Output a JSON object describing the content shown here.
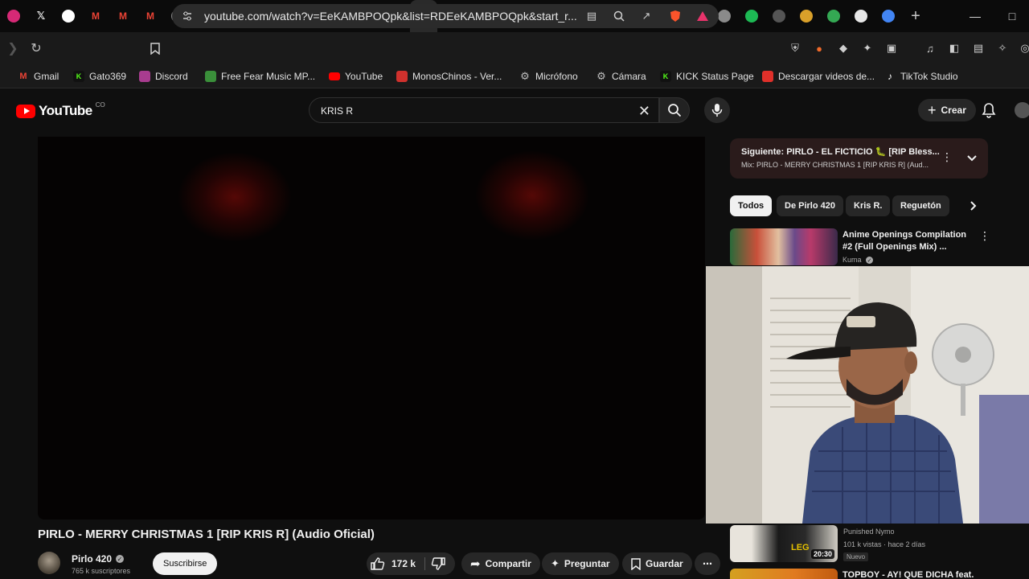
{
  "browser": {
    "tabs": [
      {
        "icon": "instagram-icon",
        "color": "#d62976",
        "active": false
      },
      {
        "icon": "x-icon",
        "color": "#ffffff",
        "active": false
      },
      {
        "icon": "tiktok-icon",
        "color": "#ffffff",
        "active": false
      },
      {
        "icon": "gmail-icon",
        "color": "#ea4335",
        "active": false
      },
      {
        "icon": "gmail-icon",
        "color": "#ea4335",
        "active": false
      },
      {
        "icon": "gmail-icon",
        "color": "#ea4335",
        "active": false
      },
      {
        "icon": "af-icon",
        "color": "#8a8a8a",
        "active": false
      },
      {
        "icon": "af-icon",
        "color": "#8a8a8a",
        "active": false
      },
      {
        "icon": "crescent-icon",
        "color": "#e0e0e0",
        "active": false
      },
      {
        "icon": "mw-icon",
        "color": "#6a6a6a",
        "active": false
      },
      {
        "icon": "telegram-icon",
        "color": "#2aa3dd",
        "active": false
      },
      {
        "icon": "google-icon",
        "color": "#4285f4",
        "active": false
      },
      {
        "icon": "blank-icon",
        "color": "#222222",
        "active": false
      },
      {
        "icon": "youtube-icon",
        "color": "#ff0000",
        "active": false
      },
      {
        "icon": "youtube-icon",
        "color": "#ff0000",
        "active": false
      },
      {
        "icon": "close-icon",
        "color": "#e8e8e8",
        "active": true
      },
      {
        "icon": "pumpkin-icon",
        "color": "#e0792a",
        "active": false
      },
      {
        "icon": "circle-icon",
        "color": "#7a7a7a",
        "active": false
      },
      {
        "icon": "google-icon",
        "color": "#4285f4",
        "active": false
      },
      {
        "icon": "red-circle-icon",
        "color": "#b8282a",
        "active": false
      },
      {
        "icon": "circle-icon",
        "color": "#8a8a8a",
        "active": false
      },
      {
        "icon": "red-circle-icon",
        "color": "#b8282a",
        "active": false
      },
      {
        "icon": "orange-circle-icon",
        "color": "#e05a1a",
        "active": false
      },
      {
        "icon": "google-icon",
        "color": "#4285f4",
        "active": false
      },
      {
        "icon": "circle-icon",
        "color": "#9a9a9a",
        "active": false
      },
      {
        "icon": "blue-square-icon",
        "color": "#3b6cd8",
        "active": false
      },
      {
        "icon": "af-icon",
        "color": "#8a8a8a",
        "active": false
      },
      {
        "icon": "spotify-icon",
        "color": "#1db954",
        "active": false
      },
      {
        "icon": "circle-icon",
        "color": "#555555",
        "active": false
      },
      {
        "icon": "colorful-icon",
        "color": "#d9a02a",
        "active": false
      },
      {
        "icon": "drive-icon",
        "color": "#34a853",
        "active": false
      },
      {
        "icon": "mute-icon",
        "color": "#e8e8e8",
        "active": false
      },
      {
        "icon": "google-icon",
        "color": "#4285f4",
        "active": false
      }
    ],
    "url": "youtube.com/watch?v=EeKAMBPOQpk&list=RDEeKAMBPOQpk&start_r...",
    "bookmarks": [
      {
        "label": "Gmail",
        "icon": "gmail-icon",
        "color": "#ea4335"
      },
      {
        "label": "Gato369",
        "icon": "kick-icon",
        "color": "#53fc18"
      },
      {
        "label": "Discord",
        "icon": "discord-icon",
        "color": "#a83c8f"
      },
      {
        "label": "Free Fear Music MP...",
        "icon": "px-icon",
        "color": "#3a8f3a"
      },
      {
        "label": "YouTube",
        "icon": "youtube-icon",
        "color": "#ff0000"
      },
      {
        "label": "MonosChinos - Ver...",
        "icon": "monoschinos-icon",
        "color": "#d0312d"
      },
      {
        "label": "Micrófono",
        "icon": "gear-icon",
        "color": "#bdbdbd"
      },
      {
        "label": "Cámara",
        "icon": "gear-icon",
        "color": "#bdbdbd"
      },
      {
        "label": "KICK Status Page",
        "icon": "kick-icon",
        "color": "#53fc18"
      },
      {
        "label": "Descargar videos de...",
        "icon": "download-icon",
        "color": "#e0302a"
      },
      {
        "label": "TikTok Studio",
        "icon": "tiktok-icon",
        "color": "#ffffff"
      }
    ]
  },
  "youtube": {
    "logo_text": "YouTube",
    "logo_region": "CO",
    "search_query": "KRIS R",
    "create_label": "Crear"
  },
  "video": {
    "title": "PIRLO - MERRY CHRISTMAS 1 [RIP KRIS R] (Audio Oficial)",
    "channel": "Pirlo 420",
    "subscribers": "765 k suscriptores",
    "subscribe_label": "Suscribirse",
    "likes": "172 k",
    "share_label": "Compartir",
    "ask_label": "Preguntar",
    "save_label": "Guardar"
  },
  "sidebar": {
    "next_label": "Siguiente: PIRLO - EL FICTICIO 🐛 [RIP Bless...",
    "next_sub": "Mix: PIRLO - MERRY CHRISTMAS 1 [RIP KRIS R] (Aud...",
    "chips": [
      "Todos",
      "De Pirlo 420",
      "Kris R.",
      "Reguetón"
    ],
    "recs": [
      {
        "title": "Anime Openings Compilation #2 (Full Openings Mix) ...",
        "meta": "Kuma"
      },
      {
        "meta": "Punished Nymo",
        "views": "101 k vistas · hace 2 días",
        "badge": "Nuevo",
        "duration": "20:30",
        "thumb_text": "LEG"
      },
      {
        "title": "TOPBOY - AY! QUE DICHA feat."
      }
    ]
  }
}
